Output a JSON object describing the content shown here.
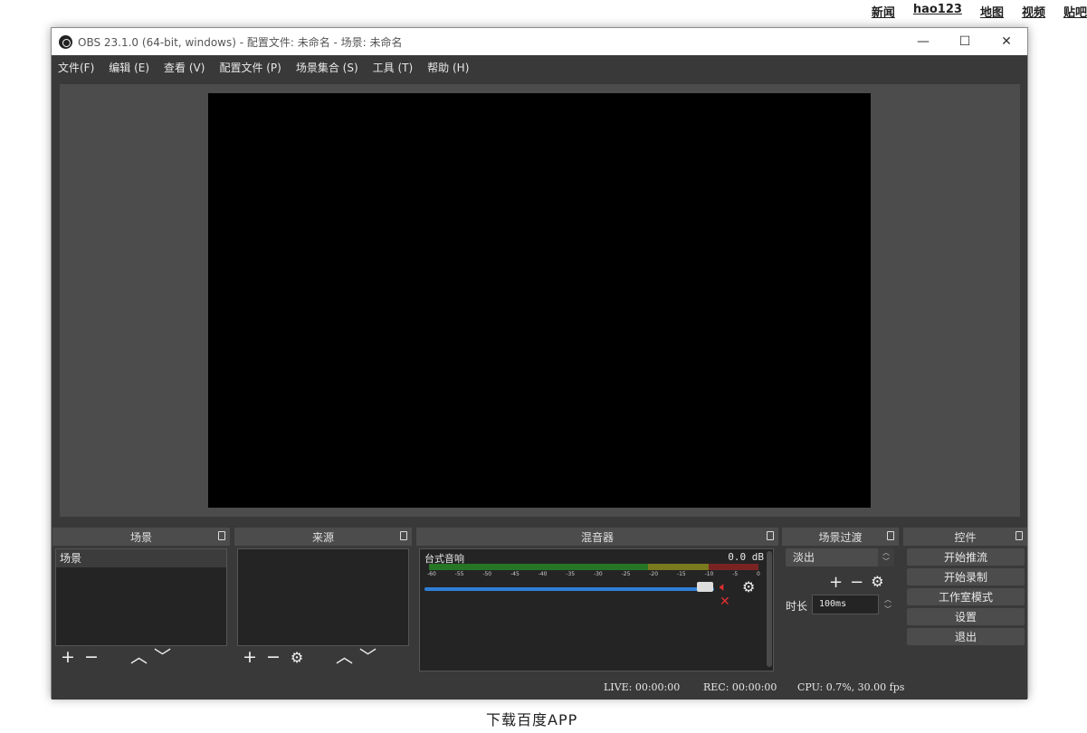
{
  "browser": {
    "top_links": [
      "新闻",
      "hao123",
      "地图",
      "视频",
      "贴吧"
    ],
    "bottom_text": "下载百度APP"
  },
  "window": {
    "title": "OBS 23.1.0 (64-bit, windows) - 配置文件: 未命名 - 场景: 未命名",
    "controls": {
      "minimize": "—",
      "maximize": "☐",
      "close": "✕"
    }
  },
  "menu": [
    "文件(F)",
    "编辑 (E)",
    "查看 (V)",
    "配置文件 (P)",
    "场景集合 (S)",
    "工具 (T)",
    "帮助 (H)"
  ],
  "docks": {
    "scenes": {
      "title": "场景",
      "items": [
        "场景"
      ]
    },
    "sources": {
      "title": "来源"
    },
    "mixer": {
      "title": "混音器",
      "channel": {
        "name": "台式音响",
        "level": "0.0 dB",
        "volume_fraction": 0.96,
        "muted": true
      },
      "ticks": [
        "-60",
        "-55",
        "-50",
        "-45",
        "-40",
        "-35",
        "-30",
        "-25",
        "-20",
        "-15",
        "-10",
        "-5",
        "0"
      ]
    },
    "transitions": {
      "title": "场景过渡",
      "selected": "淡出",
      "duration_label": "时长",
      "duration_value": "100ms"
    },
    "controls": {
      "title": "控件",
      "buttons": [
        "开始推流",
        "开始录制",
        "工作室模式",
        "设置",
        "退出"
      ]
    }
  },
  "status": {
    "live": "LIVE: 00:00:00",
    "rec": "REC: 00:00:00",
    "cpu": "CPU: 0.7%, 30.00 fps"
  }
}
